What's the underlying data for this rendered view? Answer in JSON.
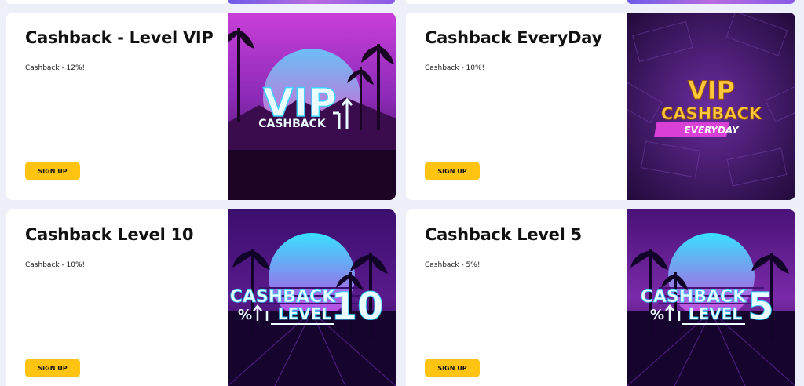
{
  "cards": [
    {
      "title": "Cashback - Level VIP",
      "desc": "Cashback - 12%!",
      "button": "SIGN UP",
      "art": {
        "line1": "VIP",
        "line2": "CASHBACK"
      }
    },
    {
      "title": "Cashback EveryDay",
      "desc": "Cashback - 10%!",
      "button": "SIGN UP",
      "art": {
        "line1": "VIP",
        "line2": "CASHBACK",
        "line3": "EVERYDAY"
      }
    },
    {
      "title": "Cashback Level 10",
      "desc": "Cashback - 10%!",
      "button": "SIGN UP",
      "art": {
        "line1": "CASHBACK",
        "line2": "LEVEL",
        "pct": "%",
        "num": "10"
      }
    },
    {
      "title": "Cashback Level 5",
      "desc": "Cashback - 5%!",
      "button": "SIGN UP",
      "art": {
        "line1": "CASHBACK",
        "line2": "LEVEL",
        "pct": "%",
        "num": "5"
      }
    }
  ],
  "colors": {
    "button": "#ffc412",
    "page_bg": "#eef0f9"
  }
}
